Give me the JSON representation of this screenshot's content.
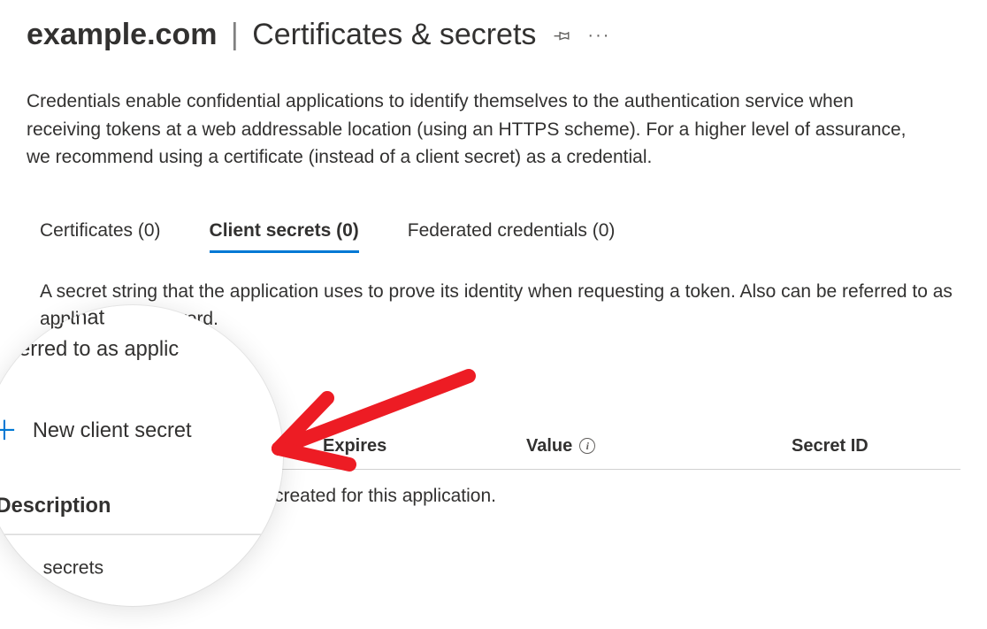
{
  "header": {
    "app_name": "example.com",
    "separator": "|",
    "section": "Certificates & secrets"
  },
  "intro": "Credentials enable confidential applications to identify themselves to the authentication service when receiving tokens at a web addressable location (using an HTTPS scheme). For a higher level of assurance, we recommend using a certificate (instead of a client secret) as a credential.",
  "tabs": [
    {
      "label": "Certificates (0)",
      "active": false
    },
    {
      "label": "Client secrets (0)",
      "active": true
    },
    {
      "label": "Federated credentials (0)",
      "active": false
    }
  ],
  "tab_description": "A secret string that the application uses to prove its identity when requesting a token. Also can be referred to as application password.",
  "actions": {
    "new_client_secret": "New client secret"
  },
  "table": {
    "columns": {
      "description": "Description",
      "expires": "Expires",
      "value": "Value",
      "secret_id": "Secret ID"
    },
    "empty_text": "No client secrets have been created for this application."
  },
  "lens": {
    "line1": "t string that",
    "line2": "eferred to as applic",
    "add_label": "New client secret",
    "desc_col": "Description",
    "empty_tail": "secrets"
  },
  "colors": {
    "accent": "#0078d4",
    "annotation": "#ed1c24"
  }
}
